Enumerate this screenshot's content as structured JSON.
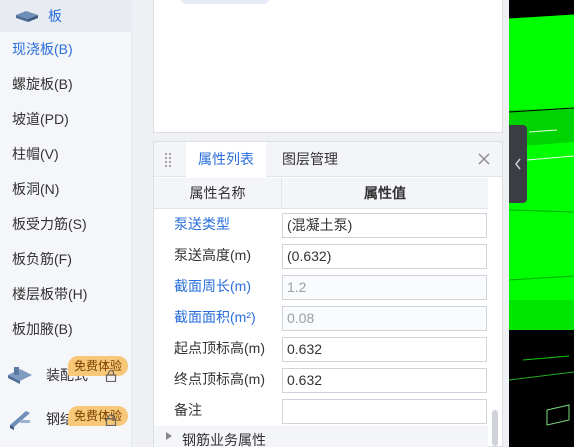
{
  "sidebar": {
    "category": {
      "label": "板",
      "icon": "slab-icon"
    },
    "items": [
      {
        "label": "现浇板(B)",
        "active": true
      },
      {
        "label": "螺旋板(B)"
      },
      {
        "label": "坡道(PD)"
      },
      {
        "label": "柱帽(V)"
      },
      {
        "label": "板洞(N)"
      },
      {
        "label": "板受力筋(S)"
      },
      {
        "label": "板负筋(F)"
      },
      {
        "label": "楼层板带(H)"
      },
      {
        "label": "板加腋(B)"
      }
    ],
    "locked_categories": [
      {
        "label": "装配式",
        "badge": "免费体验",
        "icon": "prefab-icon"
      },
      {
        "label": "钢结构",
        "badge": "免费体验",
        "icon": "steel-icon"
      }
    ]
  },
  "property_panel": {
    "tabs": [
      {
        "label": "属性列表",
        "active": true
      },
      {
        "label": "图层管理"
      }
    ],
    "headers": {
      "name": "属性名称",
      "value": "属性值"
    },
    "rows": [
      {
        "name": "泵送类型",
        "value": "(混凝土泵)",
        "link": true,
        "disabled": false
      },
      {
        "name": "泵送高度(m)",
        "value": "(0.632)",
        "link": false,
        "disabled": false
      },
      {
        "name": "截面周长(m)",
        "value": "1.2",
        "link": true,
        "disabled": true
      },
      {
        "name": "截面面积(m²)",
        "value": "0.08",
        "link": true,
        "disabled": true
      },
      {
        "name": "起点顶标高(m)",
        "value": "0.632",
        "link": false,
        "disabled": false
      },
      {
        "name": "终点顶标高(m)",
        "value": "0.632",
        "link": false,
        "disabled": false
      },
      {
        "name": "备注",
        "value": "",
        "link": false,
        "disabled": false
      }
    ],
    "group": {
      "label": "钢筋业务属性"
    }
  },
  "colors": {
    "accent": "#2a6fdb",
    "viewport_green": "#00ff00",
    "badge": "#f6c878"
  }
}
